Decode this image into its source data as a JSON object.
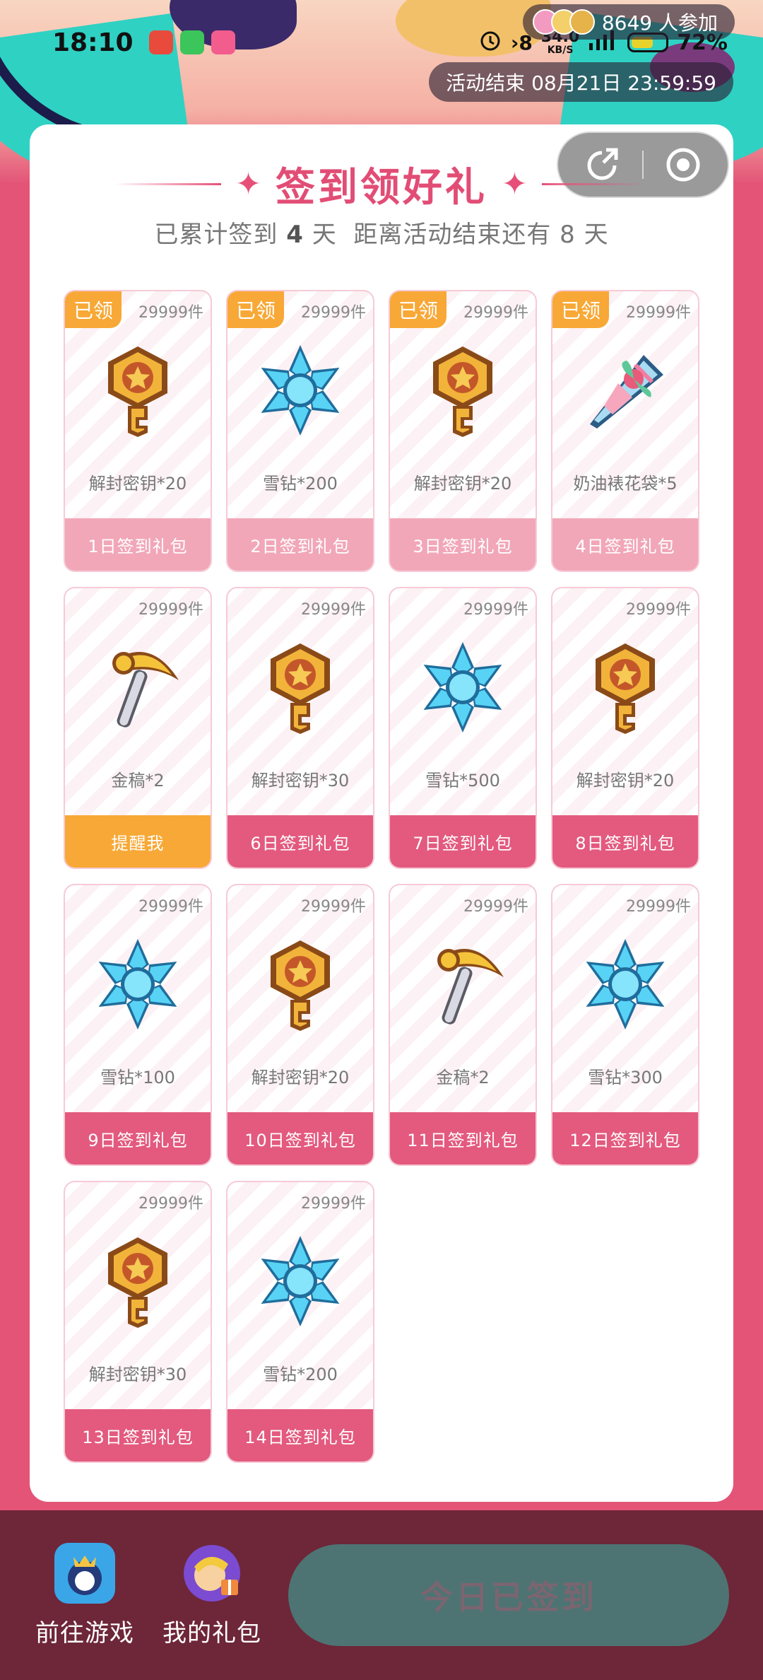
{
  "status_bar": {
    "time": "18:10",
    "net_speed_value": "34.0",
    "net_speed_unit": "KB/S",
    "battery": "72%"
  },
  "participants": {
    "text": "8649 人参加"
  },
  "event_end": {
    "text": "活动结束 08月21日 23:59:59"
  },
  "header": {
    "title": "签到领好礼",
    "subtitle_prefix": "已累计签到",
    "signed_days": "4",
    "subtitle_mid": "天  距离活动结束还有",
    "remaining_days": "8",
    "subtitle_suffix": "天"
  },
  "rewards": [
    {
      "day_label": "1日签到礼包",
      "item": "解封密钥*20",
      "count": "29999件",
      "claimed": "已领",
      "icon": "key-icon"
    },
    {
      "day_label": "2日签到礼包",
      "item": "雪钻*200",
      "count": "29999件",
      "claimed": "已领",
      "icon": "snow-diamond-icon"
    },
    {
      "day_label": "3日签到礼包",
      "item": "解封密钥*20",
      "count": "29999件",
      "claimed": "已领",
      "icon": "key-icon"
    },
    {
      "day_label": "4日签到礼包",
      "item": "奶油裱花袋*5",
      "count": "29999件",
      "claimed": "已领",
      "icon": "piping-bag-icon"
    },
    {
      "day_label": "提醒我",
      "item": "金稿*2",
      "count": "29999件",
      "icon": "pickaxe-icon"
    },
    {
      "day_label": "6日签到礼包",
      "item": "解封密钥*30",
      "count": "29999件",
      "icon": "key-icon"
    },
    {
      "day_label": "7日签到礼包",
      "item": "雪钻*500",
      "count": "29999件",
      "icon": "snow-diamond-icon"
    },
    {
      "day_label": "8日签到礼包",
      "item": "解封密钥*20",
      "count": "29999件",
      "icon": "key-icon"
    },
    {
      "day_label": "9日签到礼包",
      "item": "雪钻*100",
      "count": "29999件",
      "icon": "snow-diamond-icon"
    },
    {
      "day_label": "10日签到礼包",
      "item": "解封密钥*20",
      "count": "29999件",
      "icon": "key-icon"
    },
    {
      "day_label": "11日签到礼包",
      "item": "金稿*2",
      "count": "29999件",
      "icon": "pickaxe-icon"
    },
    {
      "day_label": "12日签到礼包",
      "item": "雪钻*300",
      "count": "29999件",
      "icon": "snow-diamond-icon"
    },
    {
      "day_label": "13日签到礼包",
      "item": "解封密钥*30",
      "count": "29999件",
      "icon": "key-icon"
    },
    {
      "day_label": "14日签到礼包",
      "item": "雪钻*200",
      "count": "29999件",
      "icon": "snow-diamond-icon"
    }
  ],
  "bottom": {
    "go_game": "前往游戏",
    "my_gifts": "我的礼包",
    "signed_button": "今日已签到"
  },
  "colors": {
    "accent": "#e24d75",
    "claimed_badge": "#f8a836",
    "bottom_bar": "#6e2639",
    "signed_button": "#4d7473"
  }
}
